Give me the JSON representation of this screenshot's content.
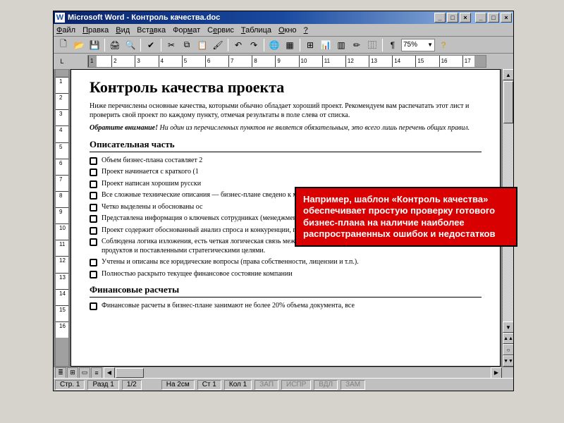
{
  "titlebar": {
    "app": "Microsoft Word",
    "filename": "Контроль качества.doc",
    "logo_letter": "W"
  },
  "menu": [
    "Файл",
    "Правка",
    "Вид",
    "Вставка",
    "Формат",
    "Сервис",
    "Таблица",
    "Окно",
    "?"
  ],
  "toolbar": {
    "zoom": "75%"
  },
  "ruler": {
    "h_numbers": [
      "1",
      "2",
      "3",
      "4",
      "5",
      "6",
      "7",
      "8",
      "9",
      "10",
      "11",
      "12",
      "13",
      "14",
      "15",
      "16",
      "17"
    ],
    "v_numbers": [
      "1",
      "2",
      "3",
      "4",
      "5",
      "6",
      "7",
      "8",
      "9",
      "10",
      "11",
      "12",
      "13",
      "14",
      "15",
      "16"
    ]
  },
  "document": {
    "title": "Контроль качества проекта",
    "intro": "Ниже перечислены основные качества, которыми обычно обладает хороший проект. Рекомендуем вам распечатать этот лист и проверить свой проект по каждому пункту, отмечая результаты в поле слева от списка.",
    "note_lead": "Обратите внимание!",
    "note_rest": " Ни один из перечисленных пунктов не является обязательным, это всего лишь перечень общих правил.",
    "section1": "Описательная часть",
    "items1": [
      "Объем бизнес-плана составляет 2",
      "Проект начинается с краткого (1",
      "Проект написан хорошим русски",
      "Все сложные технические описа­ния — бизнес-плане сведено к минимум",
      "Четко выделены и обоснованы ос",
      "Представлена информация о ключевых сотрудниках (менеджменте) проекта",
      "Проект содержит обоснованный анализ спроса и конкуренции, подтвержденный данными независимых источников.",
      "Соблюдена логика изложения, есть четкая логическая связь между маркетинговым анализом, методами продвижения продуктов и поставленными стратегическими целями.",
      "Учтены и описаны все юридические вопросы (права собственности, лицензии и т.п.).",
      "Полностью раскрыто текущее финансовое состояние компании"
    ],
    "section2": "Финансовые расчеты",
    "items2": [
      "Финансовые расчеты в бизнес-плане занимают не более 20% объема документа, все"
    ]
  },
  "callout": {
    "text": "Например, шаблон «Контроль качества» обеспечивает простую проверку готового бизнес-плана на наличие наиболее распространенных ошибок и недостатков"
  },
  "status": {
    "page": "Стр. 1",
    "section": "Разд 1",
    "pages": "1/2",
    "at": "На 2см",
    "line": "Ст 1",
    "col": "Кол 1",
    "ind1": "ЗАП",
    "ind2": "ИСПР",
    "ind3": "ВДЛ",
    "ind4": "ЗАМ"
  },
  "winbtns": {
    "min": "_",
    "max": "□",
    "close": "×"
  }
}
